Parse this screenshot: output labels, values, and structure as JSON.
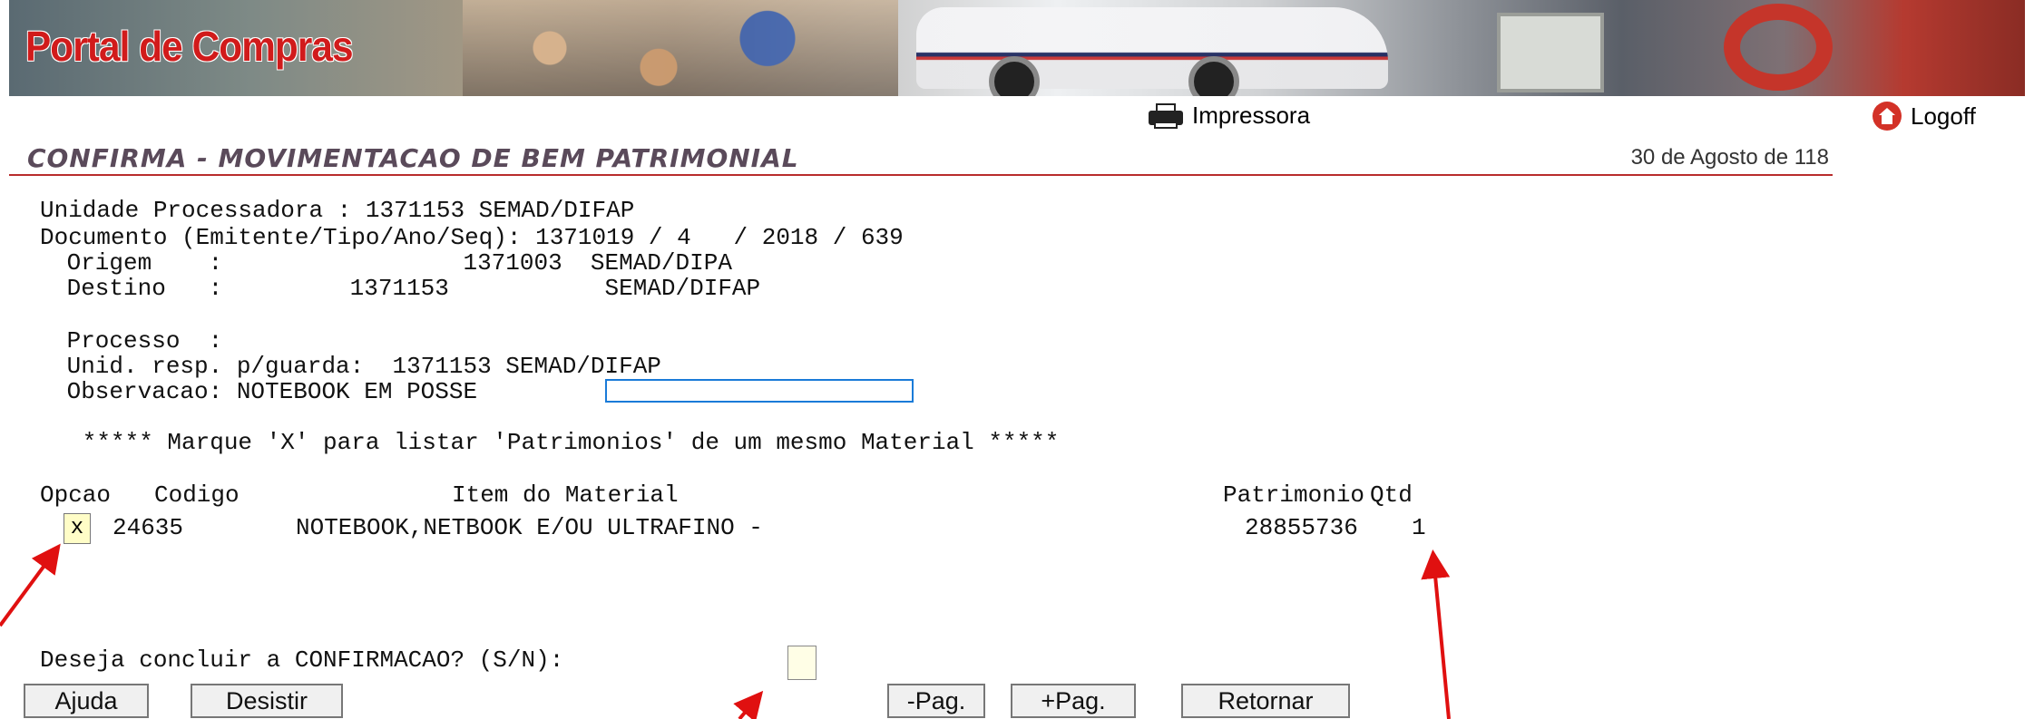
{
  "banner": {
    "title": "Portal de Compras"
  },
  "toolbar": {
    "print_label": "Impressora",
    "logoff_label": "Logoff"
  },
  "header": {
    "title": "CONFIRMA - MOVIMENTACAO DE BEM PATRIMONIAL",
    "date": "30 de Agosto de 118"
  },
  "form": {
    "unidade": "Unidade Processadora : 1371153 SEMAD/DIFAP",
    "documento": "Documento (Emitente/Tipo/Ano/Seq): 1371019 / 4   / 2018 / 639",
    "origem": " Origem    :                 1371003  SEMAD/DIPA",
    "destino": " Destino   :         1371153           SEMAD/DIFAP",
    "processo": " Processo  :",
    "unid_resp": " Unid. resp. p/guarda:  1371153 SEMAD/DIFAP",
    "observacao": " Observacao: NOTEBOOK EM POSSE",
    "instruction": "   ***** Marque 'X' para listar 'Patrimonios' de um mesmo Material *****",
    "confirm_question": "Deseja concluir a CONFIRMACAO? (S/N):"
  },
  "table": {
    "headers": {
      "opcao": "Opcao",
      "codigo": "Codigo",
      "item": "Item do Material",
      "patrimonio": "Patrimonio",
      "qtd": "Qtd"
    },
    "rows": [
      {
        "opcao": "x",
        "codigo": "24635",
        "item": "NOTEBOOK,NETBOOK E/OU ULTRAFINO -",
        "patrimonio": "28855736",
        "qtd": "1"
      }
    ]
  },
  "buttons": {
    "ajuda": "Ajuda",
    "desistir": "Desistir",
    "prev_page": "-Pag.",
    "next_page": "+Pag.",
    "retornar": "Retornar"
  },
  "colors": {
    "accent_red": "#d11b1b",
    "rule": "#b92c2c",
    "arrow": "#e01010",
    "input_highlight": "#fffdc7"
  }
}
